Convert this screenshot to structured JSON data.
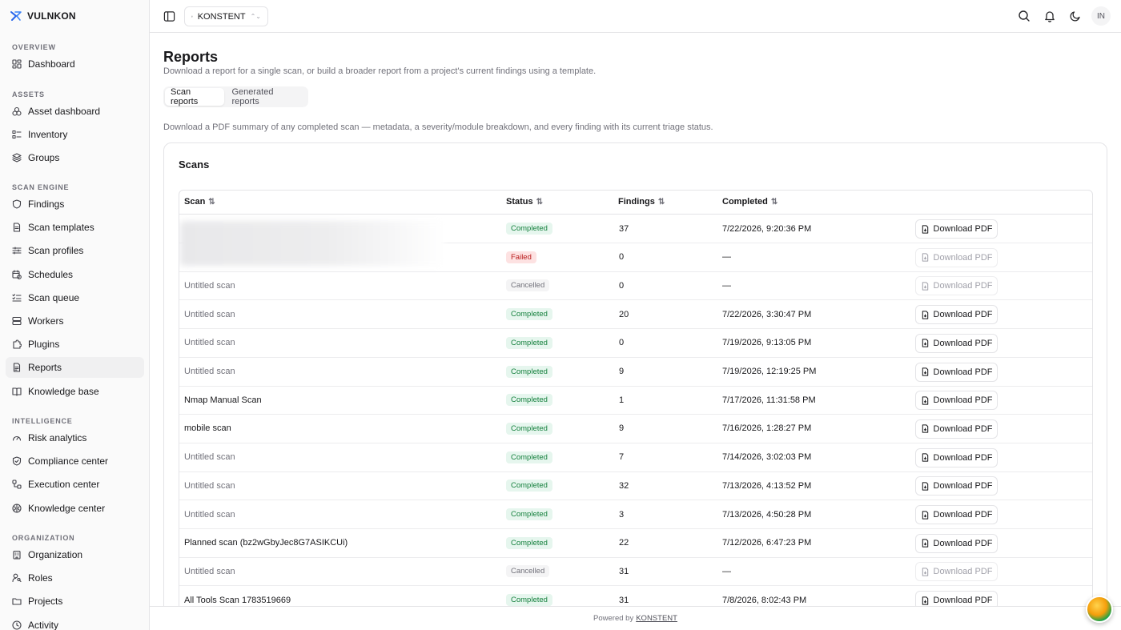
{
  "brand": {
    "name": "VULNKON"
  },
  "sidebar": {
    "sections": [
      {
        "label": "OVERVIEW",
        "items": [
          {
            "label": "Dashboard",
            "icon": "dashboard-icon"
          }
        ]
      },
      {
        "label": "ASSETS",
        "items": [
          {
            "label": "Asset dashboard",
            "icon": "asset-dashboard-icon"
          },
          {
            "label": "Inventory",
            "icon": "inventory-icon"
          },
          {
            "label": "Groups",
            "icon": "layers-icon"
          }
        ]
      },
      {
        "label": "SCAN ENGINE",
        "items": [
          {
            "label": "Findings",
            "icon": "shield-icon"
          },
          {
            "label": "Scan templates",
            "icon": "document-icon"
          },
          {
            "label": "Scan profiles",
            "icon": "sliders-icon"
          },
          {
            "label": "Schedules",
            "icon": "calendar-clock-icon"
          },
          {
            "label": "Scan queue",
            "icon": "list-checks-icon"
          },
          {
            "label": "Workers",
            "icon": "server-icon"
          },
          {
            "label": "Plugins",
            "icon": "puzzle-icon"
          },
          {
            "label": "Reports",
            "icon": "report-icon",
            "active": true
          },
          {
            "label": "Knowledge base",
            "icon": "book-icon"
          }
        ]
      },
      {
        "label": "INTELLIGENCE",
        "items": [
          {
            "label": "Risk analytics",
            "icon": "gauge-icon"
          },
          {
            "label": "Compliance center",
            "icon": "shield-check-icon"
          },
          {
            "label": "Execution center",
            "icon": "workflow-icon"
          },
          {
            "label": "Knowledge center",
            "icon": "brain-icon"
          }
        ]
      },
      {
        "label": "ORGANIZATION",
        "items": [
          {
            "label": "Organization",
            "icon": "building-icon"
          },
          {
            "label": "Roles",
            "icon": "user-key-icon"
          },
          {
            "label": "Projects",
            "icon": "folder-icon"
          },
          {
            "label": "Activity",
            "icon": "clock-icon"
          }
        ]
      }
    ]
  },
  "topbar": {
    "org": "KONSTENT",
    "avatar": "IN"
  },
  "page": {
    "title": "Reports",
    "subtitle": "Download a report for a single scan, or build a broader report from a project's current findings using a template.",
    "tabs": [
      {
        "label": "Scan reports",
        "active": true
      },
      {
        "label": "Generated reports",
        "active": false
      }
    ],
    "tab_description": "Download a PDF summary of any completed scan — metadata, a severity/module breakdown, and every finding with its current triage status."
  },
  "scans_card": {
    "title": "Scans",
    "columns": [
      "Scan",
      "Status",
      "Findings",
      "Completed"
    ],
    "download_label": "Download PDF",
    "rows": [
      {
        "scan": "",
        "muted": false,
        "status": "Completed",
        "findings": "37",
        "completed": "7/22/2026, 9:20:36 PM",
        "download_enabled": true
      },
      {
        "scan": "",
        "muted": false,
        "status": "Failed",
        "findings": "0",
        "completed": "—",
        "download_enabled": false
      },
      {
        "scan": "Untitled scan",
        "muted": true,
        "status": "Cancelled",
        "findings": "0",
        "completed": "—",
        "download_enabled": false
      },
      {
        "scan": "Untitled scan",
        "muted": true,
        "status": "Completed",
        "findings": "20",
        "completed": "7/22/2026, 3:30:47 PM",
        "download_enabled": true
      },
      {
        "scan": "Untitled scan",
        "muted": true,
        "status": "Completed",
        "findings": "0",
        "completed": "7/19/2026, 9:13:05 PM",
        "download_enabled": true
      },
      {
        "scan": "Untitled scan",
        "muted": true,
        "status": "Completed",
        "findings": "9",
        "completed": "7/19/2026, 12:19:25 PM",
        "download_enabled": true
      },
      {
        "scan": "Nmap Manual Scan",
        "muted": false,
        "status": "Completed",
        "findings": "1",
        "completed": "7/17/2026, 11:31:58 PM",
        "download_enabled": true
      },
      {
        "scan": "mobile scan",
        "muted": false,
        "status": "Completed",
        "findings": "9",
        "completed": "7/16/2026, 1:28:27 PM",
        "download_enabled": true
      },
      {
        "scan": "Untitled scan",
        "muted": true,
        "status": "Completed",
        "findings": "7",
        "completed": "7/14/2026, 3:02:03 PM",
        "download_enabled": true
      },
      {
        "scan": "Untitled scan",
        "muted": true,
        "status": "Completed",
        "findings": "32",
        "completed": "7/13/2026, 4:13:52 PM",
        "download_enabled": true
      },
      {
        "scan": "Untitled scan",
        "muted": true,
        "status": "Completed",
        "findings": "3",
        "completed": "7/13/2026, 4:50:28 PM",
        "download_enabled": true
      },
      {
        "scan": "Planned scan (bz2wGbyJec8G7ASIKCUi)",
        "muted": false,
        "status": "Completed",
        "findings": "22",
        "completed": "7/12/2026, 6:47:23 PM",
        "download_enabled": true
      },
      {
        "scan": "Untitled scan",
        "muted": true,
        "status": "Cancelled",
        "findings": "31",
        "completed": "—",
        "download_enabled": false
      },
      {
        "scan": "All Tools Scan 1783519669",
        "muted": false,
        "status": "Completed",
        "findings": "31",
        "completed": "7/8/2026, 8:02:43 PM",
        "download_enabled": true
      }
    ]
  },
  "footer": {
    "prefix": "Powered by",
    "link": "KONSTENT"
  }
}
